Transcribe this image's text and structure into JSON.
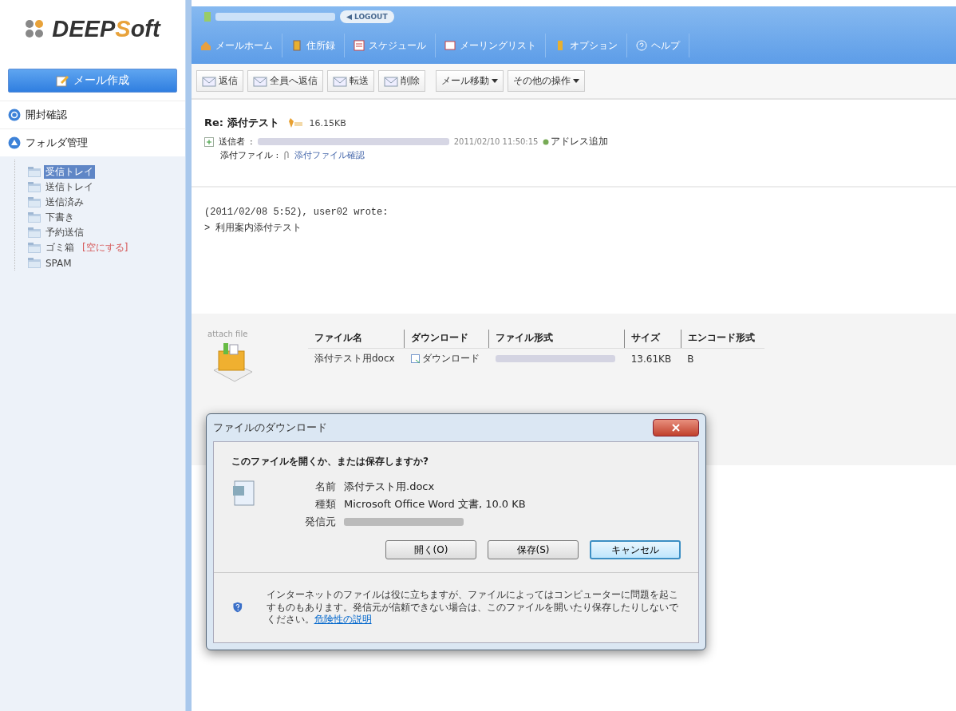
{
  "logo": {
    "parts": [
      {
        "text": "DEEP",
        "accent": false
      },
      {
        "text": "S",
        "accent": true
      },
      {
        "text": "oft",
        "accent": false
      }
    ]
  },
  "sidebar": {
    "compose_button": "メール作成",
    "sections": [
      {
        "label": "開封確認"
      },
      {
        "label": "フォルダ管理"
      }
    ],
    "folders": [
      {
        "label": "受信トレイ",
        "selected": true
      },
      {
        "label": "送信トレイ",
        "selected": false
      },
      {
        "label": "送信済み",
        "selected": false
      },
      {
        "label": "下書き",
        "selected": false
      },
      {
        "label": "予約送信",
        "selected": false
      },
      {
        "label": "ゴミ箱",
        "selected": false,
        "action": "[空にする]"
      },
      {
        "label": "SPAM",
        "selected": false
      }
    ]
  },
  "topbar": {
    "logout": "LOGOUT",
    "nav": [
      {
        "label": "メールホーム"
      },
      {
        "label": "住所録"
      },
      {
        "label": "スケジュール"
      },
      {
        "label": "メーリングリスト"
      },
      {
        "label": "オプション"
      },
      {
        "label": "ヘルプ"
      }
    ]
  },
  "toolbar": {
    "buttons": [
      {
        "label": "返信",
        "menu": false
      },
      {
        "label": "全員へ返信",
        "menu": false
      },
      {
        "label": "転送",
        "menu": false
      },
      {
        "label": "削除",
        "menu": false
      },
      {
        "label": "メール移動",
        "menu": true
      },
      {
        "label": "その他の操作",
        "menu": true
      }
    ]
  },
  "message": {
    "subject": "Re: 添付テスト",
    "size": "16.15KB",
    "sender_label": "送信者",
    "separator": ":",
    "date": "2011/02/10 11:50:15",
    "add_address": "アドレス追加",
    "attachment_label": "添付ファイル :",
    "attachment_link": "添付ファイル確認",
    "body": [
      "(2011/02/08 5:52), user02 wrote:",
      "> 利用案内添付テスト"
    ]
  },
  "attachments": {
    "caption": "attach file",
    "columns": [
      "ファイル名",
      "ダウンロード",
      "ファイル形式",
      "サイズ",
      "エンコード形式"
    ],
    "rows": [
      {
        "file_name": "添付テスト用docx",
        "download": "ダウンロード",
        "size": "13.61KB",
        "encoding": "B"
      }
    ]
  },
  "dialog": {
    "title": "ファイルのダウンロード",
    "question": "このファイルを開くか、または保存しますか?",
    "fields": [
      {
        "label": "名前",
        "value": "添付テスト用.docx"
      },
      {
        "label": "種類",
        "value": "Microsoft Office Word 文書, 10.0 KB"
      },
      {
        "label": "発信元"
      }
    ],
    "buttons": [
      {
        "label": "開く(O)",
        "focused": false
      },
      {
        "label": "保存(S)",
        "focused": false
      },
      {
        "label": "キャンセル",
        "focused": true
      }
    ],
    "warning": "インターネットのファイルは役に立ちますが、ファイルによってはコンピューターに問題を起こすものもあります。発信元が信頼できない場合は、このファイルを開いたり保存したりしないでください。",
    "warning_link": "危険性の説明"
  }
}
